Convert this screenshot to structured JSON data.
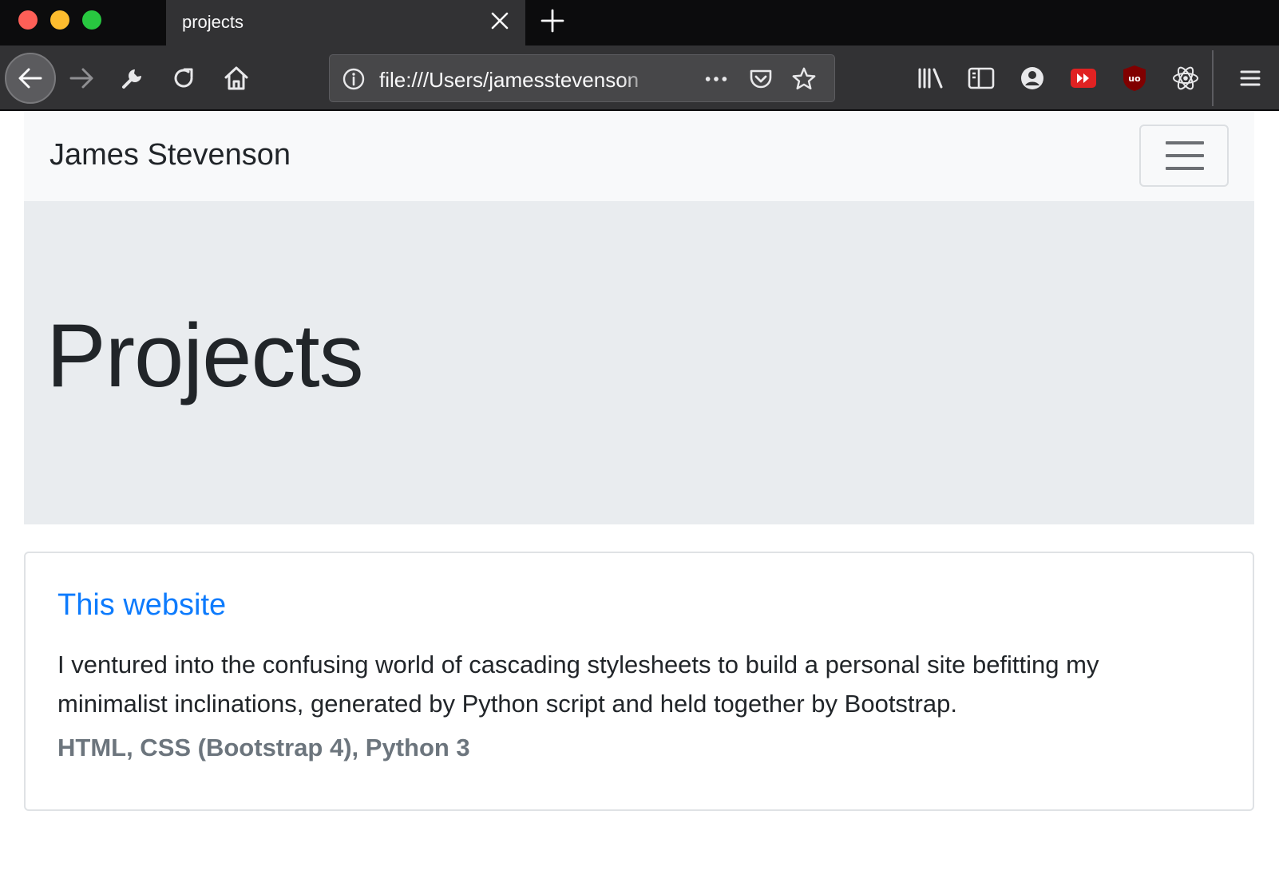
{
  "browser": {
    "tab": {
      "title": "projects"
    },
    "url": "file:///Users/jamesstevenson",
    "icons": [
      "back-icon",
      "forward-icon",
      "wrench-icon",
      "reload-icon",
      "home-icon",
      "info-icon",
      "more-dots-icon",
      "pocket-icon",
      "bookmark-star-icon",
      "library-icon",
      "sidebar-icon",
      "account-icon",
      "youtube-extension-icon",
      "ublock-icon",
      "react-devtools-icon",
      "hamburger-menu-icon"
    ],
    "colors": {
      "tabbar": "#0c0c0d",
      "toolbar": "#323234",
      "urlbar": "#474749"
    }
  },
  "site": {
    "brand": "James Stevenson",
    "jumbotron": {
      "title": "Projects"
    },
    "projects": [
      {
        "title": "This website",
        "description": "I ventured into the confusing world of cascading stylesheets to build a personal site befitting my minimalist inclinations, generated by Python script and held together by Bootstrap.",
        "tech": "HTML, CSS (Bootstrap 4), Python 3"
      }
    ],
    "colors": {
      "link": "#0d7bfd",
      "muted": "#6c757d",
      "jumbotron": "#e9ecef",
      "navbar": "#f8f9fa"
    }
  }
}
